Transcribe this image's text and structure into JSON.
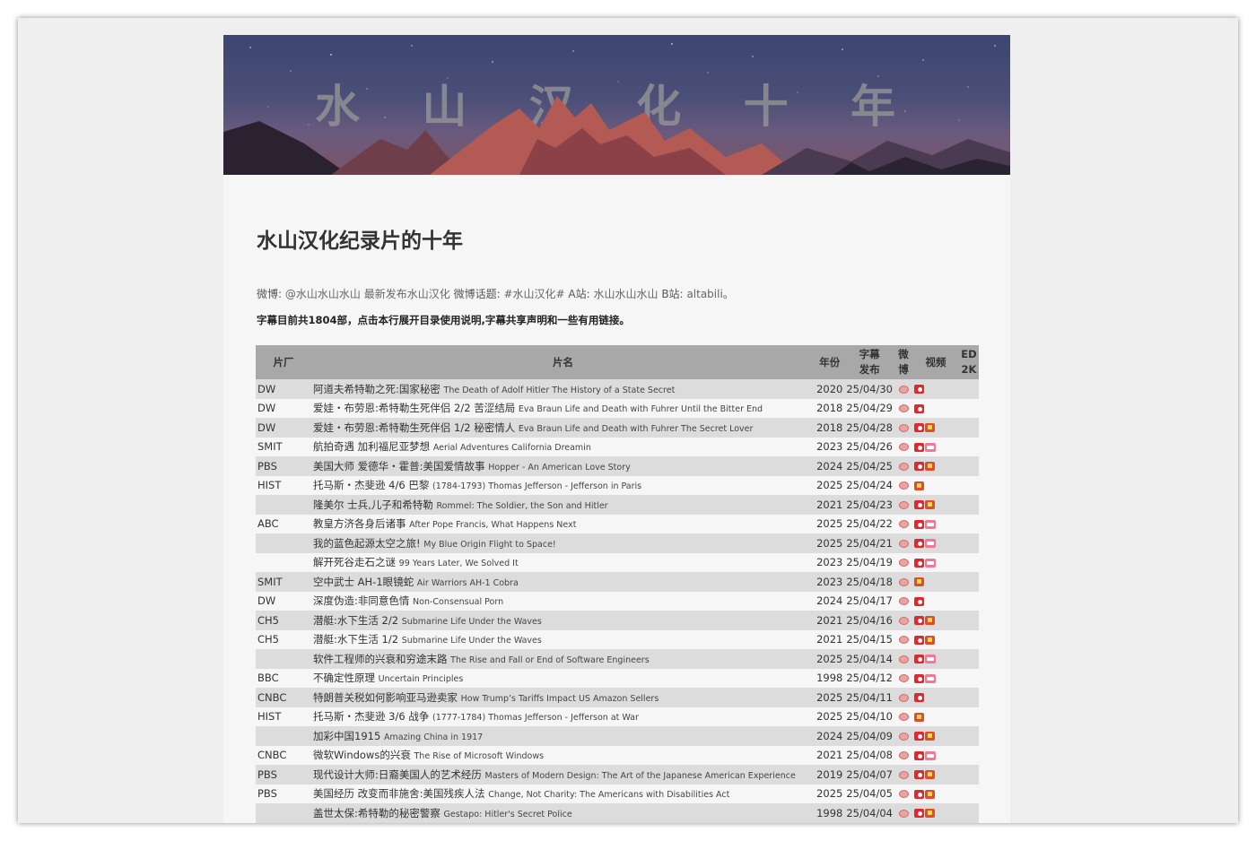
{
  "banner": {
    "title": "水 山 汉 化 十 年"
  },
  "heading": "水山汉化纪录片的十年",
  "info": {
    "weibo_label": "微博:",
    "weibo_account": "@水山水山水山",
    "weibo_latest": "最新发布水山汉化",
    "topic_label": "微博话题:",
    "topic": "#水山汉化#",
    "acfun_label": "A站:",
    "acfun_account": "水山水山水山",
    "bili_label": "B站:",
    "bili_account": "altabili",
    "end": "。"
  },
  "notice": "字幕目前共1804部，点击本行展开目录使用说明,字幕共享声明和一些有用链接。",
  "table": {
    "headers": {
      "studio": "片厂",
      "title": "片名",
      "year": "年份",
      "release_1": "字幕",
      "release_2": "发布",
      "weibo_1": "微",
      "weibo_2": "博",
      "video": "视频",
      "ed_1": "ED",
      "ed_2": "2K"
    },
    "rows": [
      {
        "studio": "DW",
        "zh": "阿道夫希特勒之死:国家秘密",
        "en": "The Death of Adolf Hitler The History of a State Secret",
        "year": "2020",
        "date": "25/04/30",
        "video": [
          "weibo"
        ]
      },
      {
        "studio": "DW",
        "zh": "爱娃・布劳恩:希特勒生死伴侣 2/2 苦涩结局",
        "en": "Eva Braun Life and Death with Fuhrer Until the Bitter End",
        "year": "2018",
        "date": "25/04/29",
        "video": [
          "weibo"
        ]
      },
      {
        "studio": "DW",
        "zh": "爱娃・布劳恩:希特勒生死伴侣 1/2 秘密情人",
        "en": "Eva Braun Life and Death with Fuhrer The Secret Lover",
        "year": "2018",
        "date": "25/04/28",
        "video": [
          "weibo",
          "acfun"
        ]
      },
      {
        "studio": "SMIT",
        "zh": "航拍奇遇 加利福尼亚梦想",
        "en": "Aerial Adventures California Dreamin",
        "year": "2023",
        "date": "25/04/26",
        "video": [
          "weibo",
          "bili"
        ]
      },
      {
        "studio": "PBS",
        "zh": "美国大师 爱德华・霍普:美国爱情故事",
        "en": "Hopper - An American Love Story",
        "year": "2024",
        "date": "25/04/25",
        "video": [
          "weibo",
          "acfun"
        ]
      },
      {
        "studio": "HIST",
        "zh": "托马斯・杰斐逊 4/6 巴黎",
        "en": "(1784-1793) Thomas Jefferson - Jefferson in Paris",
        "year": "2025",
        "date": "25/04/24",
        "video": [
          "acfun"
        ]
      },
      {
        "studio": "",
        "zh": "隆美尔 士兵,儿子和希特勒",
        "en": "Rommel: The Soldier, the Son and Hitler",
        "year": "2021",
        "date": "25/04/23",
        "video": [
          "weibo",
          "acfun"
        ]
      },
      {
        "studio": "ABC",
        "zh": "教皇方济各身后诸事",
        "en": "After Pope Francis, What Happens Next",
        "year": "2025",
        "date": "25/04/22",
        "video": [
          "weibo",
          "bili"
        ]
      },
      {
        "studio": "",
        "zh": "我的蓝色起源太空之旅!",
        "en": "My Blue Origin Flight to Space!",
        "year": "2025",
        "date": "25/04/21",
        "video": [
          "weibo",
          "bili"
        ]
      },
      {
        "studio": "",
        "zh": "解开死谷走石之谜",
        "en": "99 Years Later, We Solved It",
        "year": "2023",
        "date": "25/04/19",
        "video": [
          "weibo",
          "bili"
        ]
      },
      {
        "studio": "SMIT",
        "zh": "空中武士 AH-1眼镜蛇",
        "en": "Air Warriors AH-1 Cobra",
        "year": "2023",
        "date": "25/04/18",
        "video": [
          "acfun"
        ]
      },
      {
        "studio": "DW",
        "zh": "深度伪造:非同意色情",
        "en": "Non-Consensual Porn",
        "year": "2024",
        "date": "25/04/17",
        "video": [
          "weibo"
        ]
      },
      {
        "studio": "CH5",
        "zh": "潜艇:水下生活 2/2",
        "en": "Submarine Life Under the Waves",
        "year": "2021",
        "date": "25/04/16",
        "video": [
          "weibo",
          "acfun"
        ]
      },
      {
        "studio": "CH5",
        "zh": "潜艇:水下生活 1/2",
        "en": "Submarine Life Under the Waves",
        "year": "2021",
        "date": "25/04/15",
        "video": [
          "weibo",
          "acfun"
        ]
      },
      {
        "studio": "",
        "zh": "软件工程师的兴衰和穷途末路",
        "en": "The Rise and Fall or End of Software Engineers",
        "year": "2025",
        "date": "25/04/14",
        "video": [
          "weibo",
          "bili"
        ]
      },
      {
        "studio": "BBC",
        "zh": "不确定性原理",
        "en": "Uncertain Principles",
        "year": "1998",
        "date": "25/04/12",
        "video": [
          "weibo",
          "bili"
        ]
      },
      {
        "studio": "CNBC",
        "zh": "特朗普关税如何影响亚马逊卖家",
        "en": "How Trump’s Tariffs Impact US Amazon Sellers",
        "year": "2025",
        "date": "25/04/11",
        "video": [
          "weibo"
        ]
      },
      {
        "studio": "HIST",
        "zh": "托马斯・杰斐逊 3/6 战争",
        "en": "(1777-1784) Thomas Jefferson - Jefferson at War",
        "year": "2025",
        "date": "25/04/10",
        "video": [
          "acfun"
        ]
      },
      {
        "studio": "",
        "zh": "加彩中国1915",
        "en": "Amazing China in 1917",
        "year": "2024",
        "date": "25/04/09",
        "video": [
          "weibo",
          "acfun"
        ]
      },
      {
        "studio": "CNBC",
        "zh": "微软Windows的兴衰",
        "en": "The Rise of Microsoft Windows",
        "year": "2021",
        "date": "25/04/08",
        "video": [
          "weibo",
          "bili"
        ]
      },
      {
        "studio": "PBS",
        "zh": "现代设计大师:日裔美国人的艺术经历",
        "en": "Masters of Modern Design: The Art of the Japanese American Experience",
        "year": "2019",
        "date": "25/04/07",
        "video": [
          "weibo",
          "acfun"
        ]
      },
      {
        "studio": "PBS",
        "zh": "美国经历 改变而非施舍:美国残疾人法",
        "en": "Change, Not Charity: The Americans with Disabilities Act",
        "year": "2025",
        "date": "25/04/05",
        "video": [
          "weibo",
          "acfun"
        ]
      },
      {
        "studio": "",
        "zh": "盖世太保:希特勒的秘密警察",
        "en": "Gestapo: Hitler's Secret Police",
        "year": "1998",
        "date": "25/04/04",
        "video": [
          "weibo",
          "acfun"
        ]
      }
    ]
  }
}
